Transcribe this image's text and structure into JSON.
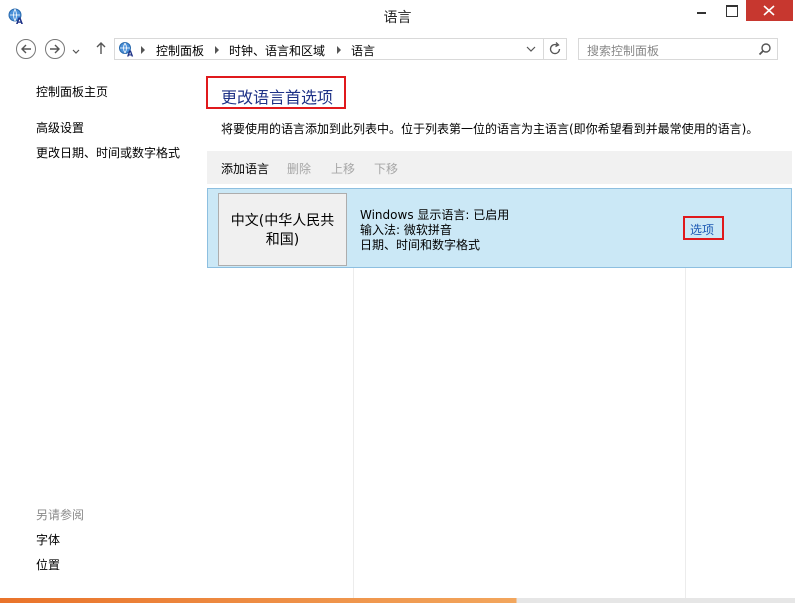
{
  "window": {
    "title": "语言"
  },
  "address": {
    "crumbs": [
      "控制面板",
      "时钟、语言和区域",
      "语言"
    ]
  },
  "search": {
    "placeholder": "搜索控制面板"
  },
  "sidebar": {
    "home": "控制面板主页",
    "links": [
      "高级设置",
      "更改日期、时间或数字格式"
    ],
    "see_also_heading": "另请参阅",
    "see_also": [
      "字体",
      "位置"
    ]
  },
  "main": {
    "title": "更改语言首选项",
    "description": "将要使用的语言添加到此列表中。位于列表第一位的语言为主语言(即你希望看到并最常使用的语言)。",
    "toolbar": {
      "add": "添加语言",
      "remove": "删除",
      "up": "上移",
      "down": "下移"
    },
    "languages": [
      {
        "name_line1": "中文(中华人民共",
        "name_line2": "和国)",
        "details": [
          "Windows 显示语言: 已启用",
          "输入法: 微软拼音",
          "日期、时间和数字格式"
        ],
        "options": "选项"
      }
    ]
  },
  "colors": {
    "accent_red": "#e0191c",
    "link_blue": "#1e5ab4",
    "selected_row": "#cbe8f6",
    "close_button": "#c7372f"
  }
}
